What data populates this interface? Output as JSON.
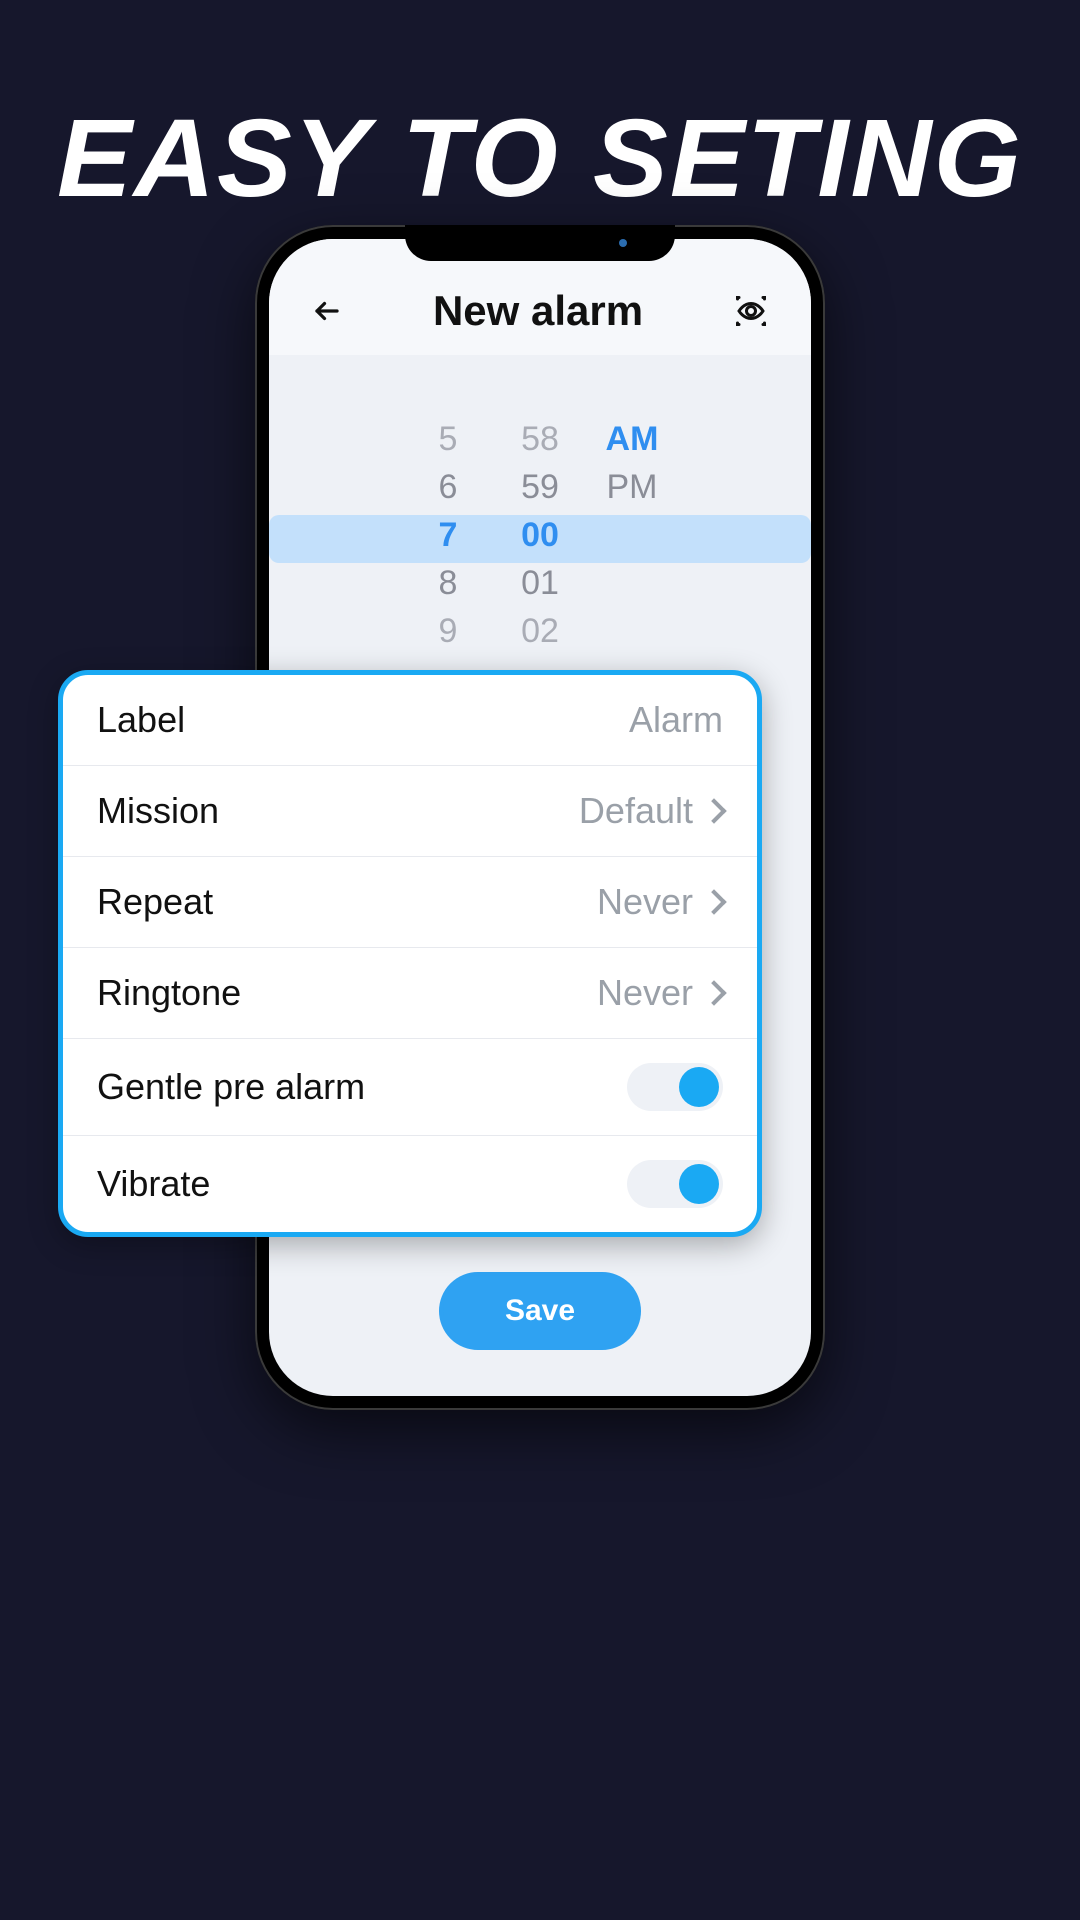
{
  "hero": "EASY TO SETING",
  "appbar": {
    "title": "New alarm"
  },
  "picker": {
    "hours": [
      "5",
      "6",
      "7",
      "8",
      "9"
    ],
    "minutes": [
      "58",
      "59",
      "00",
      "01",
      "02"
    ],
    "periods": [
      "",
      "",
      "AM",
      "PM",
      ""
    ],
    "selected_index": 2
  },
  "panel": {
    "rows": [
      {
        "label": "Label",
        "value": "Alarm",
        "type": "text"
      },
      {
        "label": "Mission",
        "value": "Default",
        "type": "nav"
      },
      {
        "label": "Repeat",
        "value": "Never",
        "type": "nav"
      },
      {
        "label": "Ringtone",
        "value": "Never",
        "type": "nav"
      },
      {
        "label": "Gentle  pre alarm",
        "type": "toggle",
        "on": true
      },
      {
        "label": "Vibrate",
        "type": "toggle",
        "on": true
      }
    ]
  },
  "save_label": "Save",
  "colors": {
    "accent": "#1aa9f3"
  }
}
